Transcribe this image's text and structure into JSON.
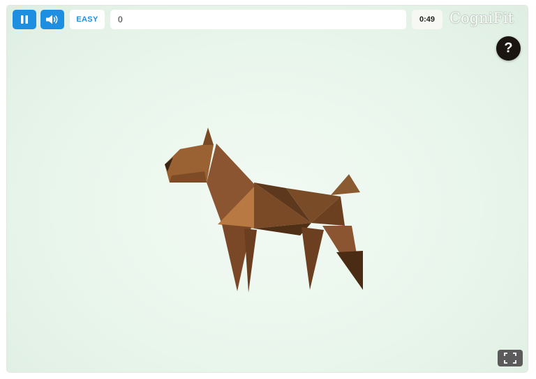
{
  "toolbar": {
    "pause_icon": "pause-icon",
    "sound_icon": "speaker-icon",
    "level_label": "EASY",
    "score_value": "0",
    "timer_value": "0:49",
    "logo_text": "CogniFit"
  },
  "help": {
    "label": "?"
  },
  "fullscreen": {
    "icon": "fullscreen-icon"
  },
  "stage": {
    "figure": "origami-dog"
  },
  "colors": {
    "accent": "#1e8fe0",
    "help_bg": "#1b1511",
    "fullscreen_bg": "#5b5b5b",
    "background": "#e9f6ec"
  }
}
